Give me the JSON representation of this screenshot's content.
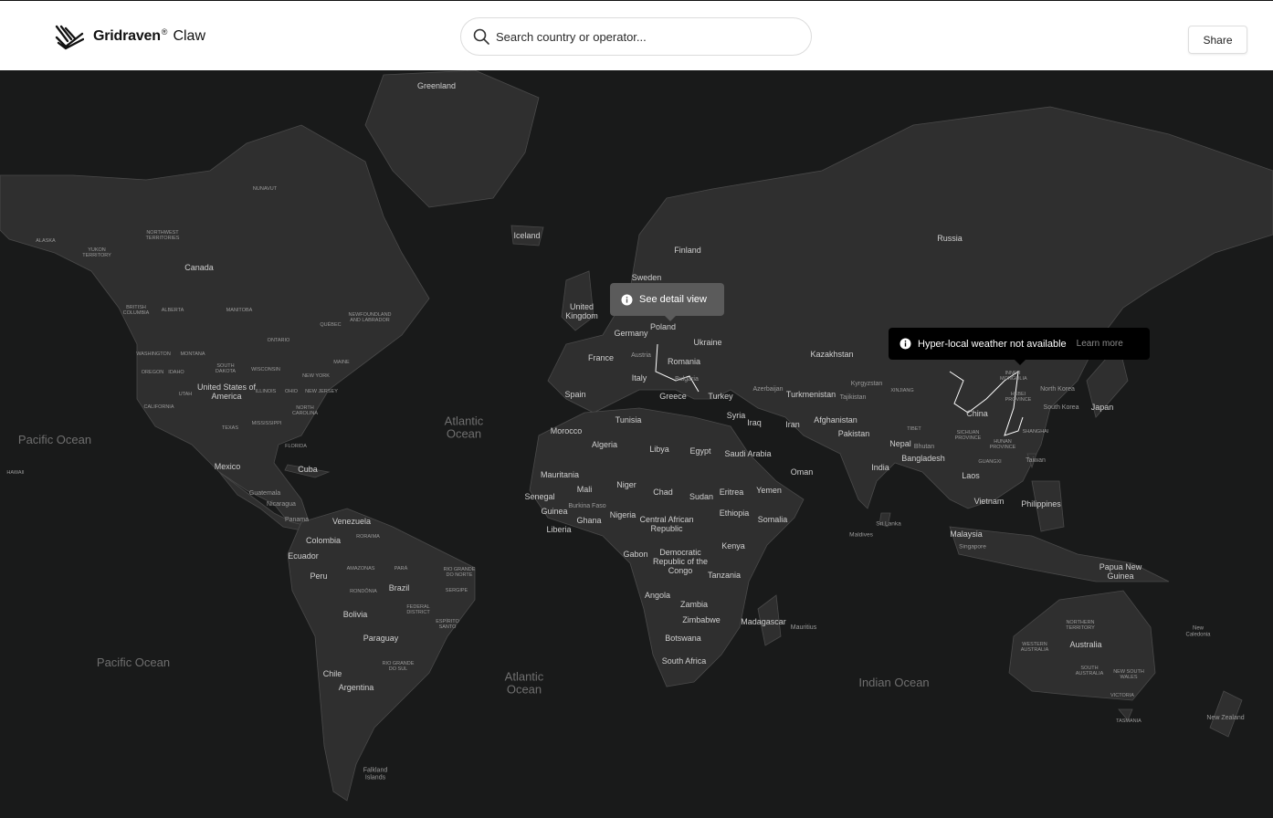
{
  "header": {
    "brand_name": "Gridraven",
    "brand_reg": "®",
    "product": "Claw",
    "search_placeholder": "Search country or operator...",
    "share_label": "Share"
  },
  "tooltips": {
    "detail_label": "See detail view",
    "weather_text": "Hyper-local weather not available",
    "weather_link": "Learn more"
  },
  "map_labels": {
    "countries": [
      "Greenland",
      "Canada",
      "United States of America",
      "Mexico",
      "Cuba",
      "Guatemala",
      "Nicaragua",
      "Panama",
      "Venezuela",
      "Colombia",
      "Ecuador",
      "Peru",
      "Brazil",
      "Bolivia",
      "Paraguay",
      "Chile",
      "Argentina",
      "Falkland Islands",
      "Iceland",
      "Finland",
      "Sweden",
      "United Kingdom",
      "Germany",
      "Poland",
      "Austria",
      "France",
      "Italy",
      "Spain",
      "Ukraine",
      "Romania",
      "Bulgaria",
      "Greece",
      "Turkey",
      "Russia",
      "Kazakhstan",
      "Kyrgyzstan",
      "Tajikistan",
      "Turkmenistan",
      "Azerbaijan",
      "Afghanistan",
      "Iran",
      "Syria",
      "Iraq",
      "Pakistan",
      "Nepal",
      "Bhutan",
      "India",
      "Bangladesh",
      "China",
      "North Korea",
      "South Korea",
      "Japan",
      "Taiwan",
      "Laos",
      "Vietnam",
      "Philippines",
      "Malaysia",
      "Singapore",
      "Sri Lanka",
      "Maldives",
      "Papua New Guinea",
      "Australia",
      "New Zealand",
      "Morocco",
      "Tunisia",
      "Algeria",
      "Libya",
      "Egypt",
      "Saudi Arabia",
      "Yemen",
      "Oman",
      "Mauritania",
      "Mali",
      "Niger",
      "Chad",
      "Sudan",
      "Eritrea",
      "Ethiopia",
      "Somalia",
      "Senegal",
      "Guinea",
      "Burkina Faso",
      "Nigeria",
      "Ghana",
      "Liberia",
      "Central African Republic",
      "Gabon",
      "Democratic Republic of the Congo",
      "Kenya",
      "Tanzania",
      "Angola",
      "Zambia",
      "Zimbabwe",
      "Botswana",
      "South Africa",
      "Madagascar",
      "Mauritius",
      "New Caledonia"
    ],
    "oceans": [
      "Pacific Ocean",
      "Pacific Ocean",
      "Atlantic Ocean",
      "Atlantic Ocean",
      "Indian Ocean"
    ],
    "regions": [
      "NUNAVUT",
      "NORTHWEST TERRITORIES",
      "ALASKA",
      "YUKON TERRITORY",
      "BRITISH COLUMBIA",
      "ALBERTA",
      "MANITOBA",
      "ONTARIO",
      "QUÉBEC",
      "NEWFOUNDLAND AND LABRADOR",
      "WASHINGTON",
      "MONTANA",
      "SOUTH DAKOTA",
      "WISCONSIN",
      "MAINE",
      "OREGON",
      "IDAHO",
      "NEW YORK",
      "UTAH",
      "ILLINOIS",
      "OHIO",
      "NEW JERSEY",
      "CALIFORNIA",
      "NORTH CAROLINA",
      "TEXAS",
      "MISSISSIPPI",
      "FLORIDA",
      "HAWAII",
      "RORAIMA",
      "PARÁ",
      "AMAZONAS",
      "RIO GRANDE DO NORTE",
      "RONDÔNIA",
      "SERGIPE",
      "FEDERAL DISTRICT",
      "ESPÍRITO SANTO",
      "RIO GRANDE DO SUL",
      "XINJIANG",
      "TIBET",
      "INNER MONGOLIA",
      "HEBEI PROVINCE",
      "SICHUAN PROVINCE",
      "HUNAN PROVINCE",
      "GUANGXI",
      "SHANGHAI",
      "NORTHERN TERRITORY",
      "WESTERN AUSTRALIA",
      "SOUTH AUSTRALIA",
      "NEW SOUTH WALES",
      "VICTORIA",
      "TASMANIA"
    ]
  },
  "colors": {
    "ocean": "#191a1a",
    "land": "#2f2f2f",
    "border": "#4a4a4a",
    "tooltip_detail_bg": "#5b5b5b",
    "tooltip_weather_bg": "#000000"
  },
  "icons": [
    "gridraven-logo-icon",
    "search-icon",
    "info-icon"
  ]
}
